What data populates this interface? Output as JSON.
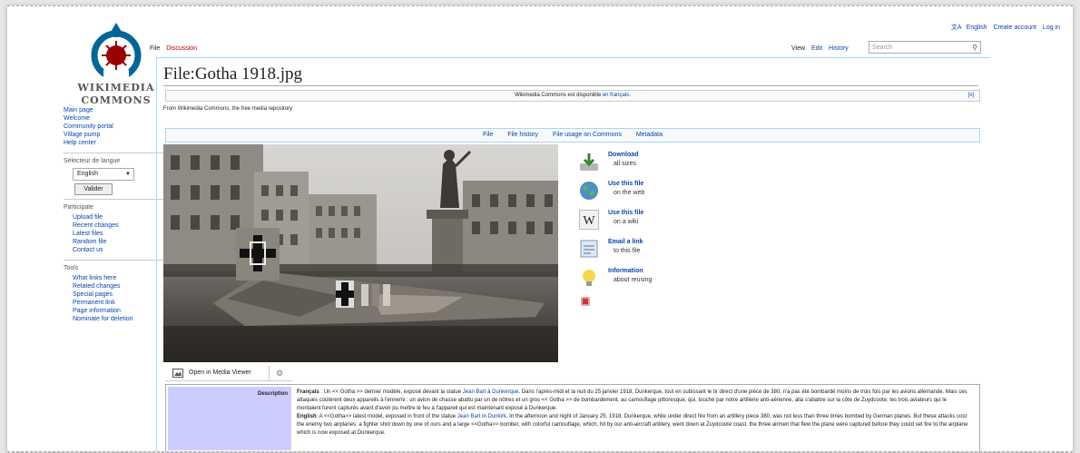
{
  "logo": {
    "line1": "WIKIMEDIA",
    "line2": "COMMONS"
  },
  "sidebar": {
    "nav": [
      "Main page",
      "Welcome",
      "Community portal",
      "Village pump",
      "Help center"
    ],
    "lang_label": "Sélecteur de langue",
    "lang_value": "English",
    "lang_button": "Valider",
    "participate_label": "Participate",
    "participate": [
      "Upload file",
      "Recent changes",
      "Latest files",
      "Random file",
      "Contact us"
    ],
    "tools_label": "Tools",
    "tools": [
      "What links here",
      "Related changes",
      "Special pages",
      "Permanent link",
      "Page information",
      "Nominate for deletion"
    ]
  },
  "top_links": {
    "lang": "English",
    "create": "Create account",
    "login": "Log in"
  },
  "tabs": {
    "file": "File",
    "discussion": "Discussion",
    "view": "View",
    "edit": "Edit",
    "history": "History"
  },
  "search": {
    "placeholder": "Search"
  },
  "page": {
    "title": "File:Gotha 1918.jpg",
    "notice_text": "Wikimedia Commons est disponible ",
    "notice_link": "en français",
    "notice_end": ".",
    "notice_close": "[x]",
    "from": "From Wikimedia Commons, the free media repository"
  },
  "file_toc": [
    "File",
    "File history",
    "File usage on Commons",
    "Metadata"
  ],
  "actions": [
    {
      "title": "Download",
      "sub": "all sizes",
      "icon": "download-icon"
    },
    {
      "title": "Use this file",
      "sub": "on the web",
      "icon": "globe-icon"
    },
    {
      "title": "Use this file",
      "sub": "on a wiki",
      "icon": "wikipedia-icon"
    },
    {
      "title": "Email a link",
      "sub": "to this file",
      "icon": "email-icon"
    },
    {
      "title": "Information",
      "sub": "about reusing",
      "icon": "lightbulb-icon"
    }
  ],
  "media_viewer": {
    "label": "Open in Media Viewer"
  },
  "description": {
    "label": "Description",
    "fr_label": "Français",
    "fr_a": " : Un << Gotha >> dernier modèle, exposé devant la statue ",
    "fr_link1": "Jean Bart",
    "fr_b": " à ",
    "fr_link2": "Dunkerque",
    "fr_c": ". Dans l'après-midi et la nuit du 25 janvier 1918, Dunkerque, tout en subissant le tir direct d'une pièce de 380, n'a pas été bombardé moins de trois fois par les avions allemande. Mais ces attaques coûtèrent deux appareils à l'ennemi : un avion de chasse abattu par un de nôtres et un gros << Gotha >> de bombardement, au camouflage pittoresque, qui, touché par notre artillerie anti-aérienne, alla s'abattre sur la côte de Zuydcoote; les trois aviateurs qui le montaient furent capturés avant d'avoir pu mettre le feu à l'appareil qui est maintenant exposé à Dunkerque.",
    "en_label": "English",
    "en_a": ": A <<Gotha>> latest model, exposed in front of the statue ",
    "en_link1": "Jean Bart",
    "en_b": " in ",
    "en_link2": "Dunkirk",
    "en_c": ". In the afternoon and night of January 25, 1918, Dunkerque, while under direct fire from an artillery piece 380, was not less than three times bombed by German planes. But these attacks cost the enemy two airplanes: a fighter shot down by one of ours and a large <<Gotha>> bomber, with colorful camouflage, which, hit by our anti-aircraft artillery, went down at Zuydcoote coast, the three airmen that flew the plane were captured before they could set fire to the airplane which is now exposed at Dunkerque."
  }
}
